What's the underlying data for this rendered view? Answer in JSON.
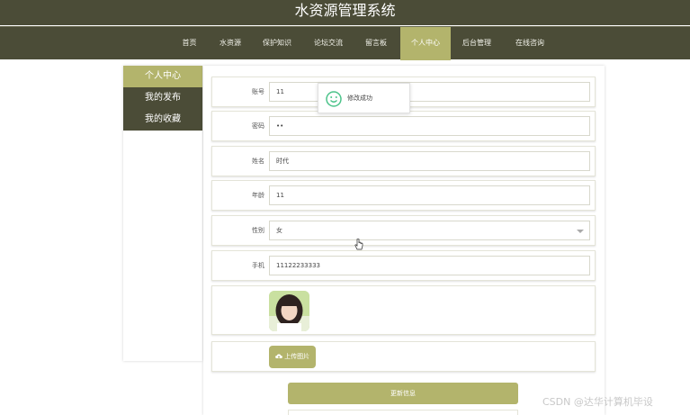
{
  "header": {
    "site_title": "水资源管理系统"
  },
  "nav": {
    "items": [
      {
        "label": "首页"
      },
      {
        "label": "水资源"
      },
      {
        "label": "保护知识"
      },
      {
        "label": "论坛交流"
      },
      {
        "label": "留言板"
      },
      {
        "label": "个人中心"
      },
      {
        "label": "后台管理"
      },
      {
        "label": "在线咨询"
      }
    ],
    "active": "个人中心"
  },
  "sidebar": {
    "items": [
      {
        "label": "个人中心"
      },
      {
        "label": "我的发布"
      },
      {
        "label": "我的收藏"
      }
    ],
    "active": "个人中心"
  },
  "form": {
    "account": {
      "label": "账号",
      "value": "11"
    },
    "password": {
      "label": "密码",
      "value": "••"
    },
    "name": {
      "label": "姓名",
      "value": "时代"
    },
    "age": {
      "label": "年龄",
      "value": "11"
    },
    "gender": {
      "label": "性别",
      "value": "女"
    },
    "phone": {
      "label": "手机",
      "value": "11122233333"
    },
    "upload_label": "上传图片",
    "submit_label": "更新信息"
  },
  "toast": {
    "message": "修改成功"
  },
  "watermark": "CSDN @达华计算机毕设",
  "colors": {
    "primary_dark": "#4b4c37",
    "accent": "#b3b46c"
  }
}
